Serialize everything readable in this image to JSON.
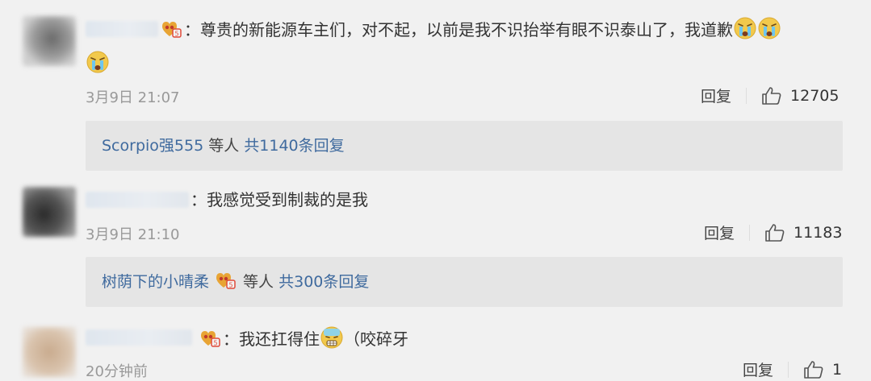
{
  "comments": [
    {
      "text_part1": "：尊贵的新能源车主们，对不起，以前是我不识抬举有眼不识泰山了，我道歉",
      "time": "3月9日 21:07",
      "reply_label": "回复",
      "likes": "12705",
      "replies_user": "Scorpio强555",
      "replies_mid": " 等人 ",
      "replies_count": "共1140条回复"
    },
    {
      "text_part1": "：我感觉受到制裁的是我",
      "time": "3月9日 21:10",
      "reply_label": "回复",
      "likes": "11183",
      "replies_user": "树荫下的小晴柔",
      "replies_mid": " 等人 ",
      "replies_count": "共300条回复"
    },
    {
      "text_part1": "：我还扛得住",
      "text_part2": "（咬碎牙",
      "time": "20分钟前",
      "reply_label": "回复",
      "likes": "1"
    }
  ],
  "icons": {
    "badge": "vip-badge-icon",
    "cry": "crying-face-emoji",
    "strain": "straining-face-emoji",
    "like": "thumbs-up-icon"
  },
  "colors": {
    "link_blue": "#3f6a9e",
    "timestamp_gray": "#999999",
    "replies_bg": "#e5e5e5",
    "page_bg": "#f1f1f1"
  }
}
